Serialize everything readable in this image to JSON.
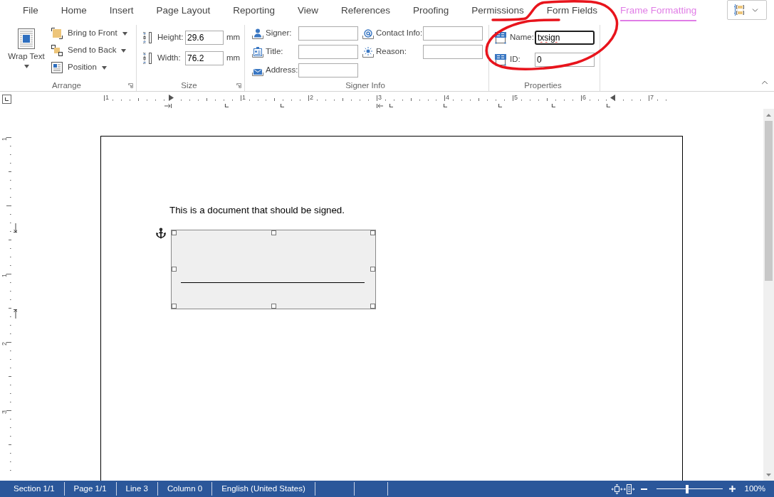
{
  "tabs": [
    {
      "label": "File",
      "selected": false
    },
    {
      "label": "Home",
      "selected": false
    },
    {
      "label": "Insert",
      "selected": false
    },
    {
      "label": "Page Layout",
      "selected": false
    },
    {
      "label": "Reporting",
      "selected": false
    },
    {
      "label": "View",
      "selected": false
    },
    {
      "label": "References",
      "selected": false
    },
    {
      "label": "Proofing",
      "selected": false
    },
    {
      "label": "Permissions",
      "selected": false
    },
    {
      "label": "Form Fields",
      "selected": false
    },
    {
      "label": "Frame Formatting",
      "selected": true
    }
  ],
  "ribbon": {
    "arrange": {
      "title": "Arrange",
      "wrap_text": "Wrap Text",
      "commands": [
        {
          "label": "Bring to Front"
        },
        {
          "label": "Send to Back"
        },
        {
          "label": "Position"
        }
      ]
    },
    "size": {
      "title": "Size",
      "fields": [
        {
          "label": "Height:",
          "value": "29.6",
          "unit": "mm"
        },
        {
          "label": "Width:",
          "value": "76.2",
          "unit": "mm"
        }
      ]
    },
    "signer_info": {
      "title": "Signer Info",
      "columns": [
        {
          "fields": [
            {
              "label": "Signer:"
            },
            {
              "label": "Title:"
            },
            {
              "label": "Address:"
            }
          ]
        },
        {
          "fields": [
            {
              "label": "Contact Info:"
            },
            {
              "label": "Reason:"
            }
          ]
        }
      ]
    },
    "properties": {
      "title": "Properties",
      "fields": [
        {
          "label": "Name:",
          "value": "txsign",
          "focused": true,
          "spell_error": true
        },
        {
          "label": "ID:",
          "value": "0",
          "focused": false,
          "spell_error": false
        }
      ]
    }
  },
  "horizontal_ruler": {
    "labels": [
      "1",
      "1",
      "2",
      "3",
      "4",
      "5",
      "6",
      "7"
    ]
  },
  "vertical_ruler": {
    "labels": [
      "1",
      "1",
      "2",
      "3"
    ]
  },
  "document": {
    "paragraph": "This is a document that should be signed.",
    "signature_frame": {
      "selected": true
    }
  },
  "status_bar": {
    "items": [
      "Section 1/1",
      "Page 1/1",
      "Line 3",
      "Column 0",
      "English (United States)"
    ],
    "zoom": {
      "level": 0.47,
      "reading": "100%"
    }
  }
}
